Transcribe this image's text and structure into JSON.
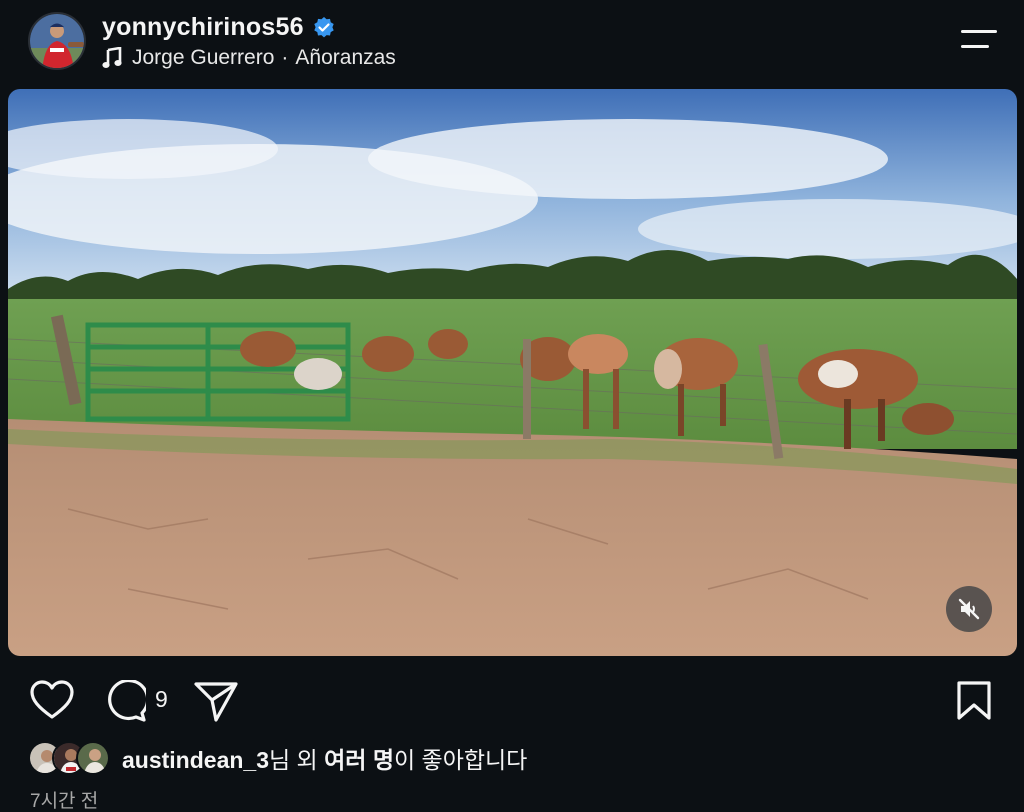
{
  "post": {
    "username": "yonnychirinos56",
    "verified": true,
    "music_artist": "Jorge Guerrero",
    "music_separator": "·",
    "music_title": "Añoranzas",
    "media_alt": "Cattle standing by a green metal gate in a field",
    "comment_count": "9",
    "liked_by_user": "austindean_3",
    "liked_by_suffix": "님 외 ",
    "liked_by_others": "여러 명",
    "liked_by_tail": "이 좋아합니다",
    "timestamp": "7시간 전"
  },
  "icons": [
    "verified-badge-icon",
    "music-note-icon",
    "menu-icon",
    "mute-icon",
    "heart-icon",
    "comment-icon",
    "share-icon",
    "bookmark-icon"
  ],
  "colors": {
    "background": "#0c1014",
    "verified": "#3897f0",
    "text": "#f5f5f5",
    "muted": "#a8a8a8"
  }
}
